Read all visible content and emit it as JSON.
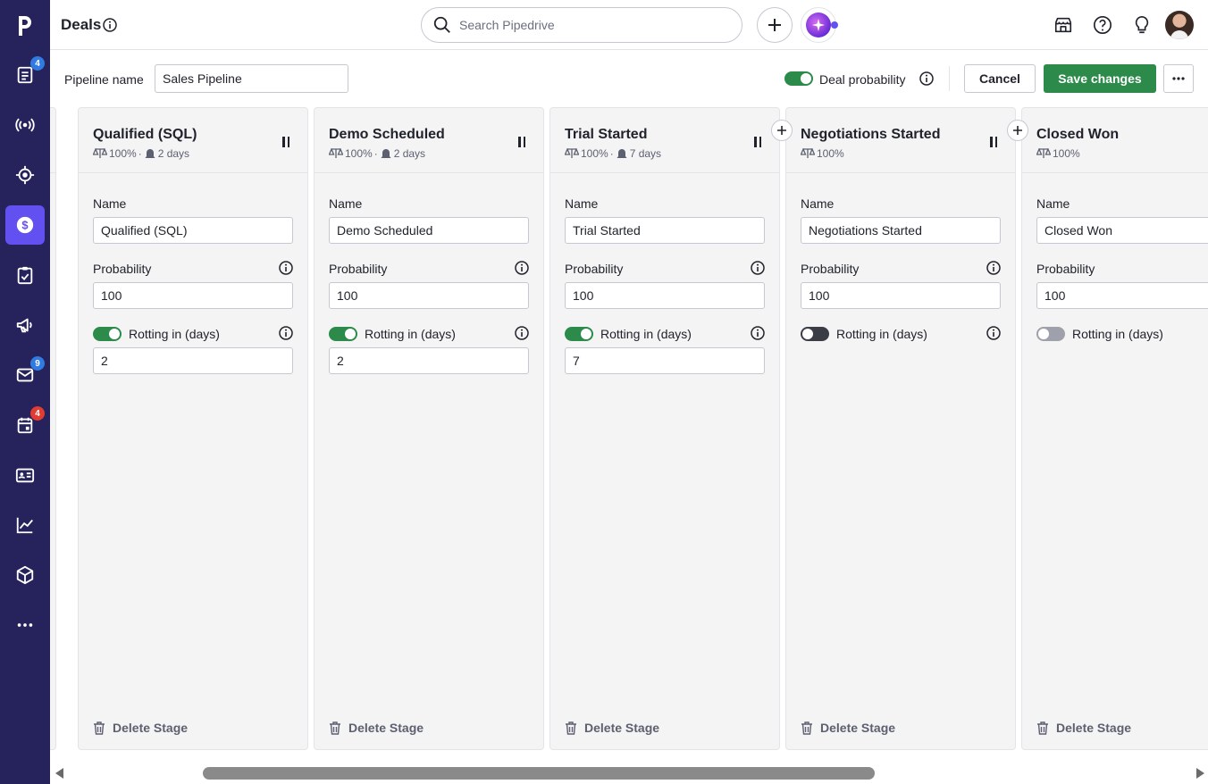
{
  "app": {
    "logo_letter": "p"
  },
  "sidebar": {
    "items": [
      {
        "name": "leads-inbox",
        "icon": "inbox-icon",
        "badge": "4",
        "badge_color": "#317ae2"
      },
      {
        "name": "campaigns",
        "icon": "broadcast-icon"
      },
      {
        "name": "projects",
        "icon": "target-icon"
      },
      {
        "name": "deals",
        "icon": "dollar-icon",
        "active": true
      },
      {
        "name": "activities",
        "icon": "clipboard-check-icon"
      },
      {
        "name": "marketing",
        "icon": "megaphone-icon"
      },
      {
        "name": "mail",
        "icon": "mail-icon",
        "badge": "9",
        "badge_color": "#317ae2"
      },
      {
        "name": "calendar",
        "icon": "calendar-icon",
        "badge": "4",
        "badge_color": "#e03c31"
      },
      {
        "name": "contacts",
        "icon": "contact-card-icon"
      },
      {
        "name": "insights",
        "icon": "chart-line-icon"
      },
      {
        "name": "products",
        "icon": "box-icon"
      },
      {
        "name": "more",
        "icon": "more-horizontal-icon"
      }
    ]
  },
  "header": {
    "title": "Deals",
    "search_placeholder": "Search Pipedrive"
  },
  "pipeline": {
    "name_label": "Pipeline name",
    "name_value": "Sales Pipeline",
    "deal_probability_label": "Deal probability",
    "deal_probability_on": true,
    "cancel_label": "Cancel",
    "save_label": "Save changes"
  },
  "field_labels": {
    "name": "Name",
    "probability": "Probability",
    "rotting": "Rotting in (days)",
    "delete": "Delete Stage"
  },
  "stages": [
    {
      "title": "Qualified (SQL)",
      "probability_meta": "100%",
      "rotting_meta": "2 days",
      "name_value": "Qualified (SQL)",
      "probability_value": "100",
      "rotting_on": true,
      "rotting_value": "2"
    },
    {
      "title": "Demo Scheduled",
      "probability_meta": "100%",
      "rotting_meta": "2 days",
      "name_value": "Demo Scheduled",
      "probability_value": "100",
      "rotting_on": true,
      "rotting_value": "2"
    },
    {
      "title": "Trial Started",
      "probability_meta": "100%",
      "rotting_meta": "7 days",
      "name_value": "Trial Started",
      "probability_value": "100",
      "rotting_on": true,
      "rotting_value": "7"
    },
    {
      "title": "Negotiations Started",
      "probability_meta": "100%",
      "name_value": "Negotiations Started",
      "probability_value": "100",
      "rotting_on": false
    },
    {
      "title": "Closed Won",
      "probability_meta": "100%",
      "name_value": "Closed Won",
      "probability_value": "100",
      "rotting_on": false
    }
  ],
  "colors": {
    "sidebar_bg": "#26225c",
    "active_item": "#6350f0",
    "primary_green": "#2c8a4a"
  }
}
